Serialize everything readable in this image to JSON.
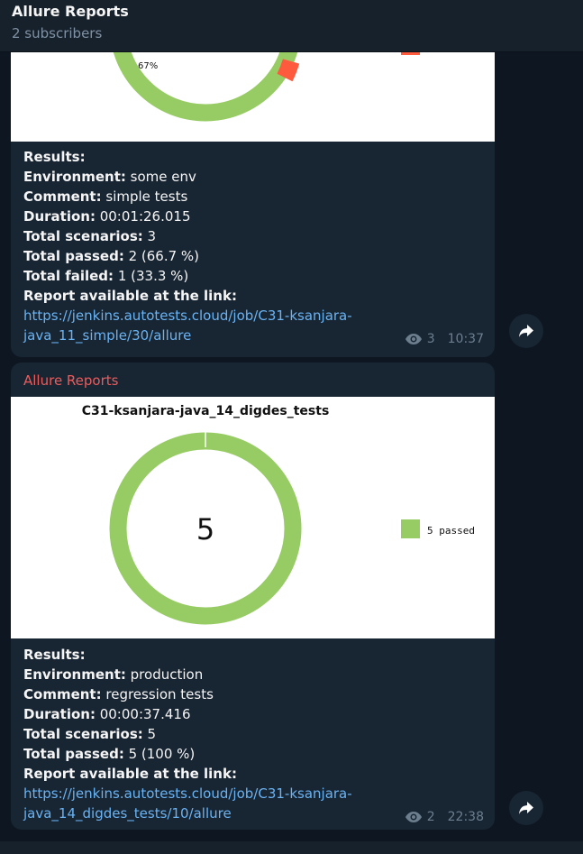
{
  "header": {
    "title": "Allure Reports",
    "subtitle": "2 subscribers"
  },
  "messages": [
    {
      "chart": {
        "percent_label": "67%"
      },
      "lines": [
        {
          "label": "Results:",
          "value": ""
        },
        {
          "label": "Environment:",
          "value": " some env"
        },
        {
          "label": "Comment:",
          "value": " simple tests"
        },
        {
          "label": "Duration:",
          "value": " 00:01:26.015"
        },
        {
          "label": "Total scenarios:",
          "value": " 3"
        },
        {
          "label": "Total passed:",
          "value": " 2 (66.7 %)"
        },
        {
          "label": "Total failed:",
          "value": " 1 (33.3 %)"
        },
        {
          "label": "Report available at the link:",
          "value": ""
        }
      ],
      "link_line1": "https://jenkins.autotests.cloud/job/C31-ksanjara-",
      "link_line2": "java_11_simple/30/allure",
      "views": "3",
      "time": "10:37"
    },
    {
      "sender": "Allure Reports",
      "chart": {
        "title": "C31-ksanjara-java_14_digdes_tests",
        "center_value": "5",
        "legend_label": "5 passed"
      },
      "lines": [
        {
          "label": "Results:",
          "value": ""
        },
        {
          "label": "Environment:",
          "value": " production"
        },
        {
          "label": "Comment:",
          "value": " regression tests"
        },
        {
          "label": "Duration:",
          "value": " 00:00:37.416"
        },
        {
          "label": "Total scenarios:",
          "value": " 5"
        },
        {
          "label": "Total passed:",
          "value": " 5 (100 %)"
        },
        {
          "label": "Report available at the link:",
          "value": ""
        }
      ],
      "link_line1": "https://jenkins.autotests.cloud/job/C31-ksanjara-",
      "link_line2": "java_14_digdes_tests/10/allure",
      "views": "2",
      "time": "22:38"
    }
  ],
  "colors": {
    "passed": "#97cc64",
    "failed": "#fd5a3e",
    "link": "#6ab3f3",
    "sender": "#ea5c5c"
  },
  "icons": {
    "views": "eye-icon",
    "forward": "share-arrow-icon"
  }
}
